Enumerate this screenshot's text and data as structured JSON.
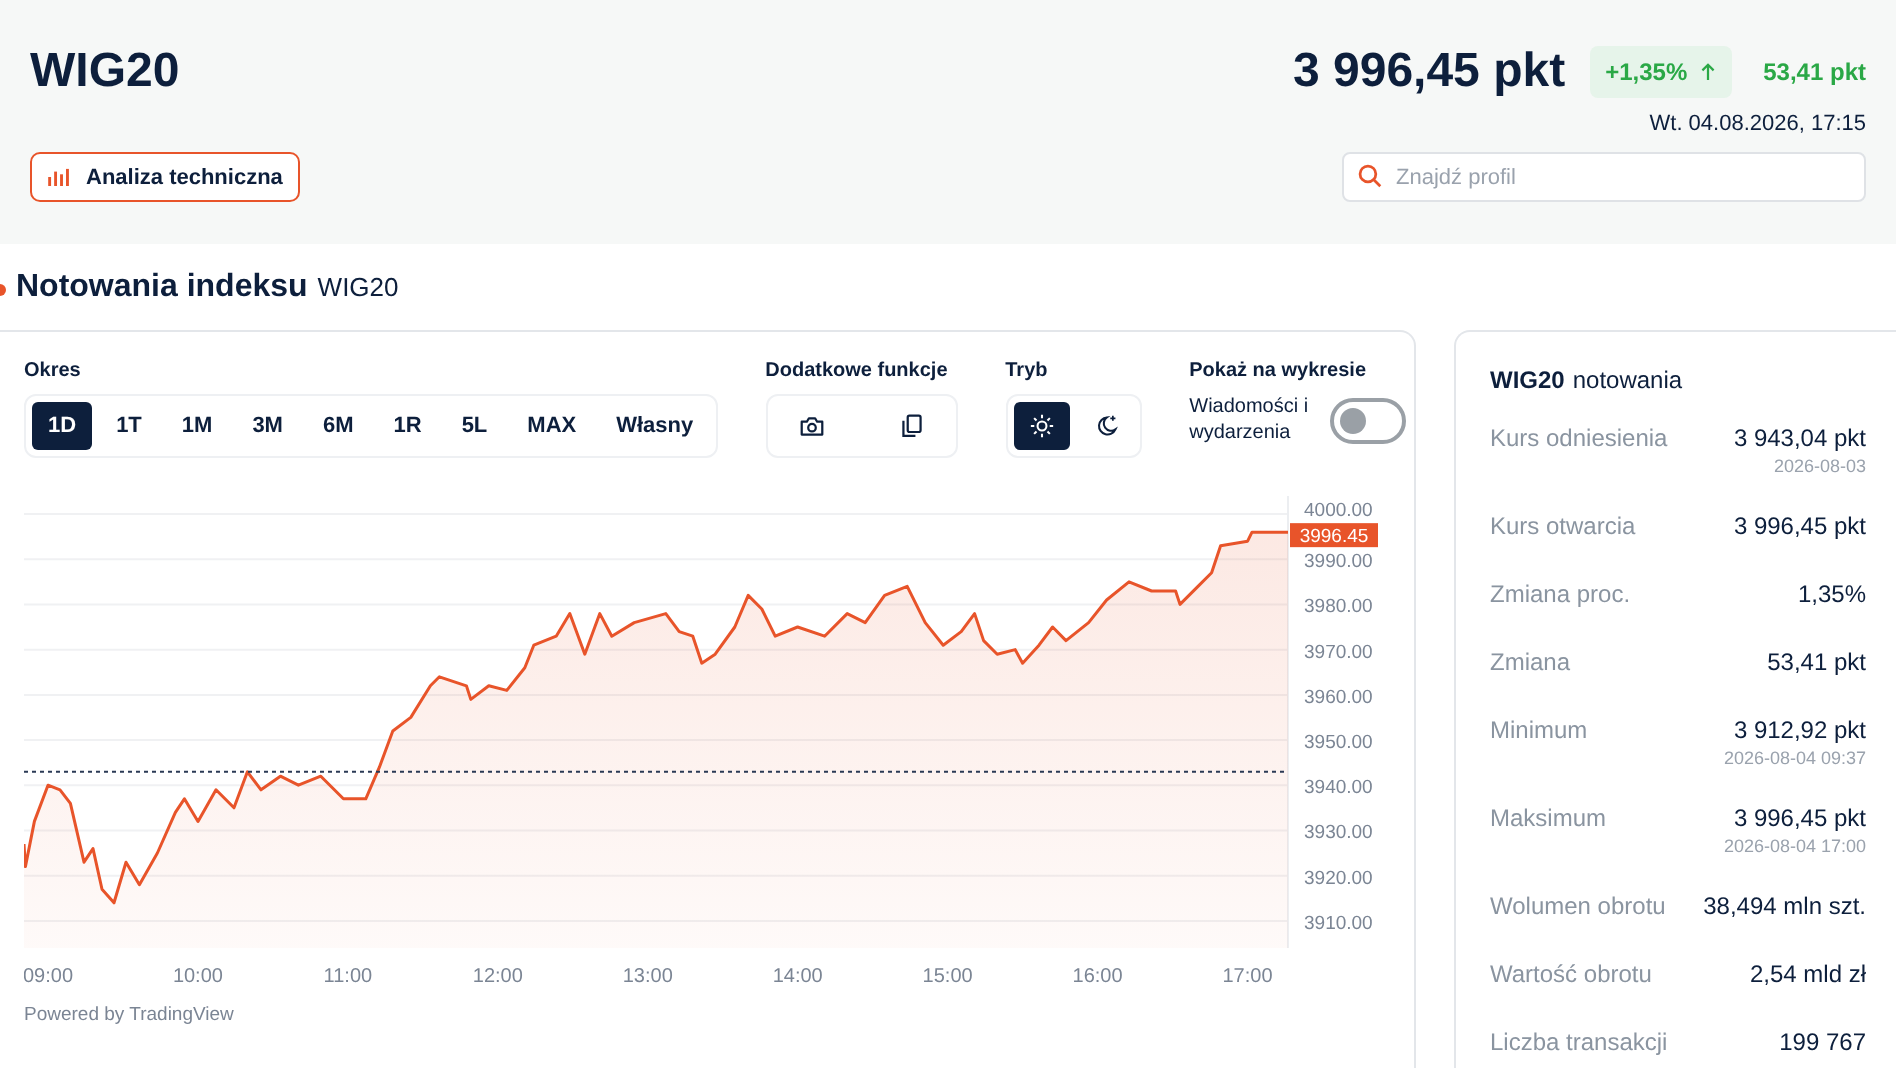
{
  "header": {
    "title": "WIG20",
    "price": "3 996,45 pkt",
    "change_percent": "+1,35%",
    "change_points": "53,41 pkt",
    "timestamp": "Wt. 04.08.2026, 17:15",
    "analysis_button": "Analiza techniczna",
    "search": {
      "placeholder": "Znajdź profil"
    }
  },
  "section": {
    "title": "Notowania indeksu",
    "subtitle": "WIG20"
  },
  "chart_panel": {
    "period_label": "Okres",
    "periods": [
      {
        "label": "1D",
        "selected": true
      },
      {
        "label": "1T",
        "selected": false
      },
      {
        "label": "1M",
        "selected": false
      },
      {
        "label": "3M",
        "selected": false
      },
      {
        "label": "6M",
        "selected": false
      },
      {
        "label": "1R",
        "selected": false
      },
      {
        "label": "5L",
        "selected": false
      },
      {
        "label": "MAX",
        "selected": false
      },
      {
        "label": "Własny",
        "selected": false
      }
    ],
    "functions_label": "Dodatkowe funkcje",
    "functions": [
      {
        "kind": "screenshot"
      },
      {
        "kind": "copy"
      }
    ],
    "mode_label": "Tryb",
    "modes": [
      {
        "kind": "light",
        "selected": true
      },
      {
        "kind": "dark",
        "selected": false
      }
    ],
    "overlay_label": "Pokaż na wykresie",
    "overlay_option": "Wiadomości i wydarzenia",
    "overlay_on": false,
    "chart_data": {
      "type": "area",
      "grid": true,
      "xlim": [
        8.84,
        17.27
      ],
      "ylim": [
        3904,
        4004
      ],
      "xticks": [
        {
          "value": 9,
          "label": "09:00"
        },
        {
          "value": 10,
          "label": "10:00"
        },
        {
          "value": 11,
          "label": "11:00"
        },
        {
          "value": 12,
          "label": "12:00"
        },
        {
          "value": 13,
          "label": "13:00"
        },
        {
          "value": 14,
          "label": "14:00"
        },
        {
          "value": 15,
          "label": "15:00"
        },
        {
          "value": 16,
          "label": "16:00"
        },
        {
          "value": 17,
          "label": "17:00"
        }
      ],
      "yticks": [
        {
          "value": 3910,
          "label": "3910.00"
        },
        {
          "value": 3920,
          "label": "3920.00"
        },
        {
          "value": 3930,
          "label": "3930.00"
        },
        {
          "value": 3940,
          "label": "3940.00"
        },
        {
          "value": 3950,
          "label": "3950.00"
        },
        {
          "value": 3960,
          "label": "3960.00"
        },
        {
          "value": 3970,
          "label": "3970.00"
        },
        {
          "value": 3980,
          "label": "3980.00"
        },
        {
          "value": 3990,
          "label": "3990.00"
        },
        {
          "value": 4000,
          "label": "4000.00"
        }
      ],
      "x": [
        8.84,
        8.85,
        8.91,
        9.0,
        9.08,
        9.15,
        9.24,
        9.3,
        9.36,
        9.44,
        9.52,
        9.61,
        9.73,
        9.85,
        9.91,
        10.0,
        10.12,
        10.24,
        10.33,
        10.42,
        10.55,
        10.67,
        10.82,
        10.97,
        11.12,
        11.21,
        11.3,
        11.42,
        11.55,
        11.61,
        11.79,
        11.82,
        11.94,
        12.06,
        12.18,
        12.24,
        12.39,
        12.48,
        12.58,
        12.68,
        12.76,
        12.91,
        13.12,
        13.21,
        13.3,
        13.36,
        13.45,
        13.58,
        13.67,
        13.76,
        13.85,
        14.0,
        14.18,
        14.33,
        14.45,
        14.58,
        14.73,
        14.85,
        14.97,
        15.09,
        15.18,
        15.24,
        15.33,
        15.45,
        15.5,
        15.61,
        15.7,
        15.79,
        15.94,
        16.06,
        16.21,
        16.36,
        16.52,
        16.55,
        16.67,
        16.76,
        16.82,
        17.0,
        17.03,
        17.27
      ],
      "series": [
        {
          "color": "#e8542a",
          "values": [
            3927,
            3922,
            3932,
            3940,
            3939,
            3936,
            3923,
            3926,
            3917,
            3914,
            3923,
            3918,
            3925,
            3934,
            3937,
            3932,
            3939,
            3935,
            3943,
            3939,
            3942,
            3940,
            3942,
            3937,
            3937,
            3944,
            3952,
            3955,
            3962,
            3964,
            3962,
            3959,
            3962,
            3961,
            3966,
            3971,
            3973,
            3978,
            3969,
            3978,
            3973,
            3976,
            3978,
            3974,
            3973,
            3967,
            3969,
            3975,
            3982,
            3979,
            3973,
            3975,
            3973,
            3978,
            3976,
            3982,
            3984,
            3976,
            3971,
            3974,
            3978,
            3972,
            3969,
            3970,
            3967,
            3971,
            3975,
            3972,
            3976,
            3981,
            3985,
            3983,
            3983,
            3980,
            3984,
            3987,
            3993,
            3994,
            3996,
            3996
          ]
        }
      ],
      "ref_lines": [
        {
          "axis": "y",
          "value": 3943
        }
      ],
      "annotations": [
        {
          "text": "3996.45",
          "x": 17.27,
          "y": 3996
        }
      ]
    },
    "attribution": "Powered by TradingView"
  },
  "quotes": {
    "title": "WIG20",
    "subtitle": "notowania",
    "rows": [
      {
        "label": "Kurs odniesienia",
        "value": "3 943,04 pkt",
        "date": "2026-08-03"
      },
      {
        "label": "Kurs otwarcia",
        "value": "3 996,45 pkt"
      },
      {
        "label": "Zmiana proc.",
        "value": "1,35%"
      },
      {
        "label": "Zmiana",
        "value": "53,41 pkt"
      },
      {
        "label": "Minimum",
        "value": "3 912,92 pkt",
        "date": "2026-08-04 09:37"
      },
      {
        "label": "Maksimum",
        "value": "3 996,45 pkt",
        "date": "2026-08-04 17:00"
      },
      {
        "label": "Wolumen obrotu",
        "value": "38,494 mln szt."
      },
      {
        "label": "Wartość obrotu",
        "value": "2,54 mld zł"
      },
      {
        "label": "Liczba transakcji",
        "value": "199 767"
      }
    ]
  }
}
